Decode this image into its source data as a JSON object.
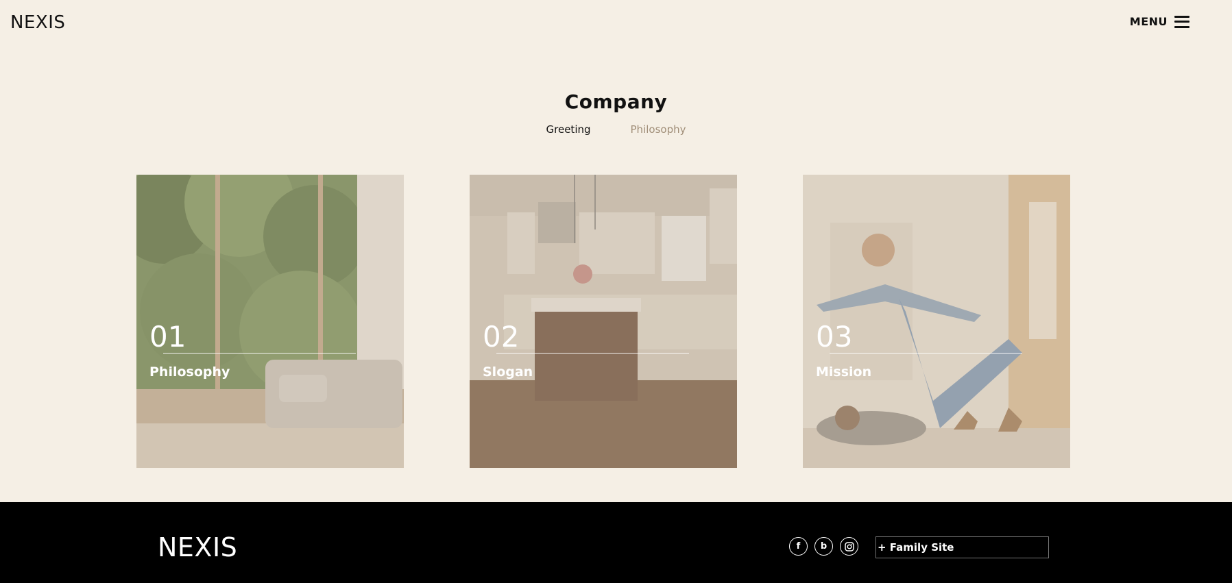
{
  "header": {
    "logo": "NEXIS",
    "menu_label": "MENU"
  },
  "page": {
    "title": "Company",
    "subnav": [
      {
        "label": "Greeting",
        "active": false
      },
      {
        "label": "Philosophy",
        "active": true
      }
    ]
  },
  "cards": [
    {
      "number": "01",
      "label": "Philosophy",
      "image": "living-room-armchair-window"
    },
    {
      "number": "02",
      "label": "Slogan",
      "image": "kitchen-island"
    },
    {
      "number": "03",
      "label": "Mission",
      "image": "father-lifting-child"
    }
  ],
  "footer": {
    "logo": "NEXIS",
    "socials": [
      {
        "icon": "facebook-icon",
        "glyph": "f"
      },
      {
        "icon": "blog-icon",
        "glyph": "b"
      },
      {
        "icon": "instagram-icon",
        "glyph": ""
      }
    ],
    "family_site_label": "+ Family Site"
  },
  "colors": {
    "background": "#f5efe5",
    "accent": "#a08e78",
    "footer": "#000000"
  }
}
